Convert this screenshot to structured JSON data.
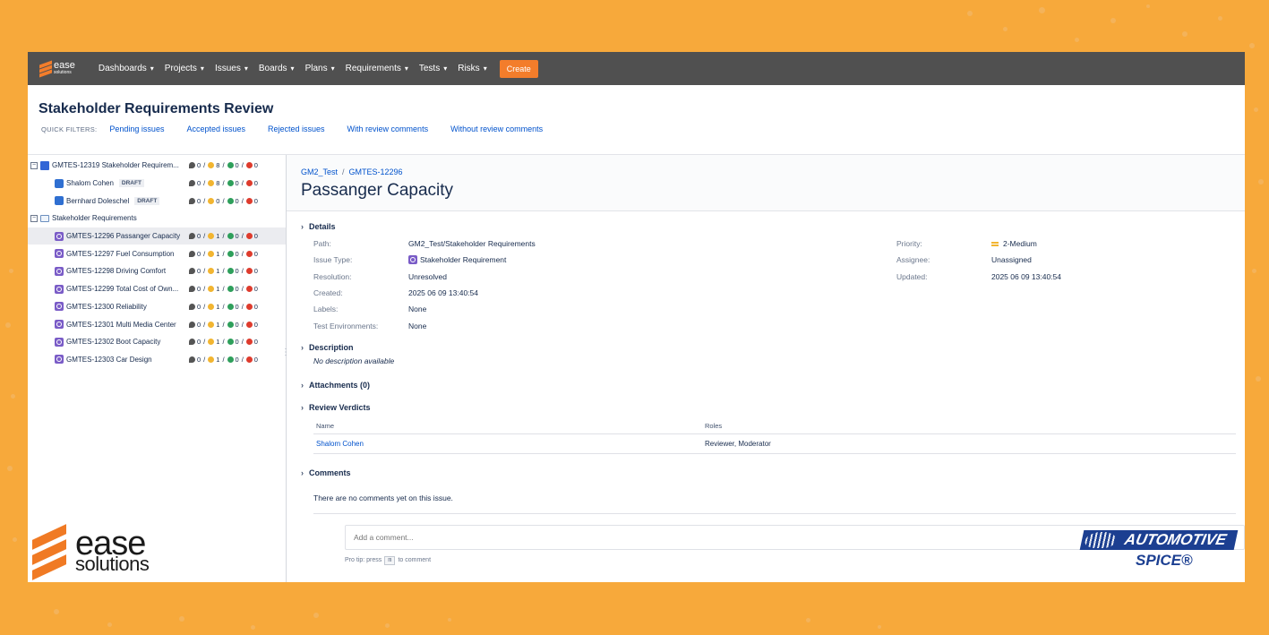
{
  "logo_small": {
    "line1": "ease",
    "line2": "solutions"
  },
  "nav": {
    "items": [
      "Dashboards",
      "Projects",
      "Issues",
      "Boards",
      "Plans",
      "Requirements",
      "Tests",
      "Risks"
    ],
    "chevron": "▾",
    "create_label": "Create"
  },
  "page": {
    "title": "Stakeholder Requirements Review",
    "quick_filters_label": "QUICK FILTERS:",
    "quick_filters": [
      "Pending issues",
      "Accepted issues",
      "Rejected issues",
      "With review comments",
      "Without review comments"
    ]
  },
  "tree": {
    "review": {
      "label": "GMTES-12319 Stakeholder Requirem...",
      "counts": [
        "0",
        "8",
        "0",
        "0"
      ]
    },
    "reviewers": [
      {
        "label": "Shalom Cohen",
        "badge": "DRAFT",
        "counts": [
          "0",
          "8",
          "0",
          "0"
        ]
      },
      {
        "label": "Bernhard Doleschel",
        "badge": "DRAFT",
        "counts": [
          "0",
          "0",
          "0",
          "0"
        ]
      }
    ],
    "folder_label": "Stakeholder Requirements",
    "issues": [
      {
        "label": "GMTES-12296 Passanger Capacity",
        "counts": [
          "0",
          "1",
          "0",
          "0"
        ]
      },
      {
        "label": "GMTES-12297 Fuel Consumption",
        "counts": [
          "0",
          "1",
          "0",
          "0"
        ]
      },
      {
        "label": "GMTES-12298 Driving Comfort",
        "counts": [
          "0",
          "1",
          "0",
          "0"
        ]
      },
      {
        "label": "GMTES-12299 Total Cost of Own...",
        "counts": [
          "0",
          "1",
          "0",
          "0"
        ]
      },
      {
        "label": "GMTES-12300 Reliability",
        "counts": [
          "0",
          "1",
          "0",
          "0"
        ]
      },
      {
        "label": "GMTES-12301 Multi Media Center",
        "counts": [
          "0",
          "1",
          "0",
          "0"
        ]
      },
      {
        "label": "GMTES-12302 Boot Capacity",
        "counts": [
          "0",
          "1",
          "0",
          "0"
        ]
      },
      {
        "label": "GMTES-12303 Car Design",
        "counts": [
          "0",
          "1",
          "0",
          "0"
        ]
      }
    ]
  },
  "issue": {
    "breadcrumb": [
      "GM2_Test",
      "GMTES-12296"
    ],
    "title": "Passanger Capacity",
    "details_label": "Details",
    "fields": [
      {
        "label": "Path:",
        "value": "GM2_Test/Stakeholder Requirements"
      },
      {
        "label": "Issue Type:",
        "value": "Stakeholder Requirement"
      },
      {
        "label": "Resolution:",
        "value": "Unresolved"
      },
      {
        "label": "Created:",
        "value": "2025 06 09 13:40:54"
      },
      {
        "label": "Labels:",
        "value": "None"
      },
      {
        "label": "Test Environments:",
        "value": "None"
      }
    ],
    "right_fields": [
      {
        "label": "Priority:",
        "value": "2-Medium"
      },
      {
        "label": "Assignee:",
        "value": "Unassigned"
      },
      {
        "label": "Updated:",
        "value": "2025 06 09 13:40:54"
      }
    ],
    "description_label": "Description",
    "description_text": "No description available",
    "attachments_label": "Attachments (0)",
    "verdicts_label": "Review Verdicts",
    "verdict_columns": [
      "Name",
      "Roles"
    ],
    "verdict_rows": [
      {
        "name": "Shalom Cohen",
        "roles": "Reviewer, Moderator"
      }
    ],
    "comments_label": "Comments",
    "no_comments": "There are no comments yet on this issue.",
    "comment_placeholder": "Add a comment...",
    "protip_prefix": "Pro tip: press",
    "protip_key": "m",
    "protip_suffix": "to comment"
  },
  "overlay": {
    "ease_word": "ease",
    "solutions_word": "solutions",
    "spice_top": "AUTOMOTIVE",
    "spice_bottom": "SPICE®"
  },
  "colors": {
    "background": "#f7a93b",
    "nav": "#505050",
    "create": "#f37d2b",
    "link": "#0052cc"
  }
}
